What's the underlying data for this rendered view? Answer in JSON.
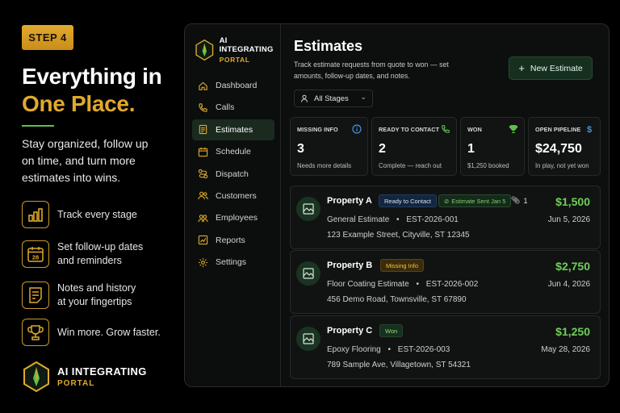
{
  "promo": {
    "step": "STEP 4",
    "headline_line1": "Everything in",
    "headline_line2": "One Place.",
    "subcopy": "Stay organized, follow up on time, and turn more estimates into wins.",
    "features": [
      {
        "icon": "bar-chart-icon",
        "text": "Track every stage"
      },
      {
        "icon": "calendar-icon",
        "calendar_day": "28",
        "text": "Set follow-up dates and reminders"
      },
      {
        "icon": "notes-icon",
        "text": "Notes and history at your fingertips"
      },
      {
        "icon": "trophy-icon",
        "text": "Win more. Grow faster."
      }
    ],
    "logo_line1": "AI INTEGRATING",
    "logo_line2": "PORTAL"
  },
  "sidebar": {
    "logo_line1": "AI INTEGRATING",
    "logo_line2": "PORTAL",
    "items": [
      {
        "label": "Dashboard",
        "icon": "home-icon"
      },
      {
        "label": "Calls",
        "icon": "phone-icon"
      },
      {
        "label": "Estimates",
        "icon": "document-icon",
        "active": true
      },
      {
        "label": "Schedule",
        "icon": "calendar-icon"
      },
      {
        "label": "Dispatch",
        "icon": "route-icon"
      },
      {
        "label": "Customers",
        "icon": "users-icon"
      },
      {
        "label": "Employees",
        "icon": "employees-icon"
      },
      {
        "label": "Reports",
        "icon": "reports-icon"
      },
      {
        "label": "Settings",
        "icon": "gear-icon"
      }
    ]
  },
  "main": {
    "title": "Estimates",
    "description": "Track estimate requests from quote to won — set amounts, follow-up dates, and notes.",
    "new_button": "New Estimate",
    "stage_filter": "All Stages"
  },
  "stats": [
    {
      "label": "MISSING INFO",
      "value": "3",
      "sub": "Needs more details",
      "icon": "info-icon"
    },
    {
      "label": "READY TO CONTACT",
      "value": "2",
      "sub": "Complete — reach out",
      "icon": "phone-icon"
    },
    {
      "label": "WON",
      "value": "1",
      "sub": "$1,250 booked",
      "icon": "trophy-icon"
    },
    {
      "label": "OPEN PIPELINE",
      "value": "$24,750",
      "sub": "In play, not yet won",
      "icon": "dollar-icon"
    }
  ],
  "estimates": [
    {
      "name": "Property A",
      "badges": [
        "Ready to Contact",
        "Estimate Sent Jan 5"
      ],
      "attachments": "1",
      "amount": "$1,500",
      "type": "General Estimate",
      "id": "EST-2026-001",
      "date": "Jun 5, 2026",
      "address": "123 Example Street, Cityville, ST 12345"
    },
    {
      "name": "Property B",
      "badges": [
        "Missing Info"
      ],
      "amount": "$2,750",
      "type": "Floor Coating Estimate",
      "id": "EST-2026-002",
      "date": "Jun 4, 2026",
      "address": "456 Demo Road, Townsville, ST 67890"
    },
    {
      "name": "Property C",
      "badges": [
        "Won"
      ],
      "amount": "$1,250",
      "type": "Epoxy Flooring",
      "id": "EST-2026-003",
      "date": "May 28, 2026",
      "address": "789 Sample Ave, Villagetown, ST 54321"
    }
  ],
  "separator": "•",
  "colors": {
    "gold": "#e0a92e",
    "green": "#6fcf5a",
    "background": "#000000",
    "panel": "#0d0f0e"
  }
}
